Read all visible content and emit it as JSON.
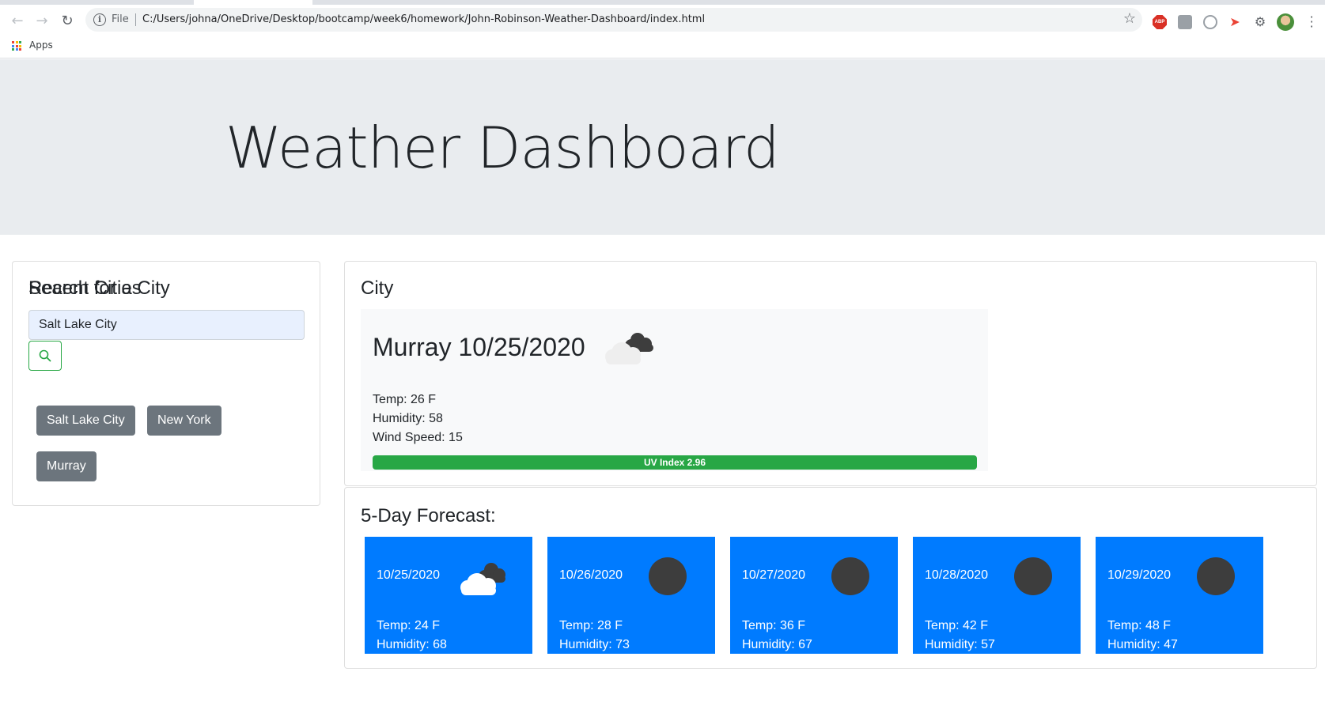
{
  "browser": {
    "scheme_label": "File",
    "url": "C:/Users/johna/OneDrive/Desktop/bootcamp/week6/homework/John-Robinson-Weather-Dashboard/index.html",
    "bookmarks_apps_label": "Apps",
    "extension_abp_label": "ABP"
  },
  "header": {
    "title": "Weather Dashboard"
  },
  "search": {
    "heading": "Search for a City",
    "input_value": "Salt Lake City",
    "recent_heading": "Recent Cities",
    "recent_cities": [
      "Salt Lake City",
      "New York",
      "Murray"
    ]
  },
  "current": {
    "section_title": "City",
    "heading": "Murray 10/25/2020",
    "icon": "broken-clouds-icon",
    "temp": "Temp: 26 F",
    "humidity": "Humidity: 58",
    "wind": "Wind Speed: 15",
    "uv_label": "UV Index 2.96",
    "uv_bar_fill": 1.0,
    "uv_color": "#28a745"
  },
  "forecast": {
    "title": "5-Day Forecast:",
    "card_color": "#007bff",
    "days": [
      {
        "date": "10/25/2020",
        "icon": "broken-clouds-icon",
        "temp": "Temp: 24 F",
        "humidity": "Humidity: 68"
      },
      {
        "date": "10/26/2020",
        "icon": "clear-night-icon",
        "temp": "Temp: 28 F",
        "humidity": "Humidity: 73"
      },
      {
        "date": "10/27/2020",
        "icon": "clear-night-icon",
        "temp": "Temp: 36 F",
        "humidity": "Humidity: 67"
      },
      {
        "date": "10/28/2020",
        "icon": "clear-night-icon",
        "temp": "Temp: 42 F",
        "humidity": "Humidity: 57"
      },
      {
        "date": "10/29/2020",
        "icon": "clear-night-icon",
        "temp": "Temp: 48 F",
        "humidity": "Humidity: 47"
      }
    ]
  }
}
